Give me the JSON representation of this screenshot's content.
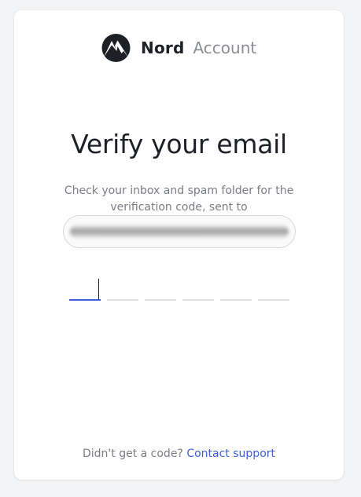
{
  "header": {
    "brand": "Nord",
    "product": "Account",
    "logo_icon": "nord-mountain-icon"
  },
  "main": {
    "title": "Verify your email",
    "subtitle": "Check your inbox and spam folder for the verification code, sent to",
    "email_display": "",
    "code_inputs": 6,
    "active_slot": 1
  },
  "footer": {
    "prompt": "Didn't get a code?",
    "link": "Contact support"
  },
  "colors": {
    "accent": "#3e5fd8",
    "text_primary": "#1e2027",
    "text_secondary": "#7a7d84"
  }
}
